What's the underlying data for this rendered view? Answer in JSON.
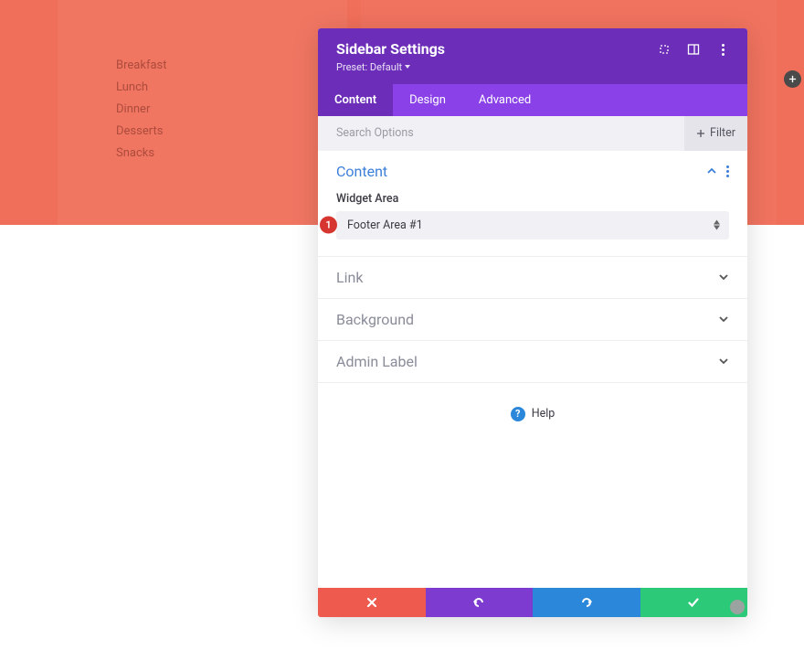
{
  "sidebar": {
    "items": [
      "Breakfast",
      "Lunch",
      "Dinner",
      "Desserts",
      "Snacks"
    ]
  },
  "modal": {
    "title": "Sidebar Settings",
    "preset_label": "Preset: Default",
    "tabs": {
      "content": "Content",
      "design": "Design",
      "advanced": "Advanced"
    },
    "search_placeholder": "Search Options",
    "filter_label": "Filter",
    "sections": {
      "content": {
        "title": "Content",
        "field_label": "Widget Area",
        "field_value": "Footer Area #1"
      },
      "link": {
        "title": "Link"
      },
      "background": {
        "title": "Background"
      },
      "admin_label": {
        "title": "Admin Label"
      }
    },
    "help_label": "Help",
    "badge_number": "1"
  }
}
